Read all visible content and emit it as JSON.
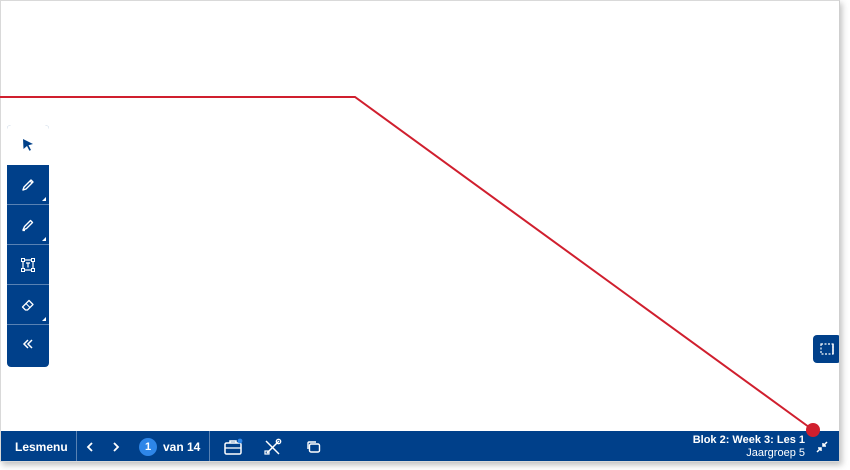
{
  "toolbar": {
    "tools": [
      {
        "icon": "cursor-icon",
        "active": true
      },
      {
        "icon": "pencil-icon"
      },
      {
        "icon": "marker-icon"
      },
      {
        "icon": "text-box-icon"
      },
      {
        "icon": "eraser-icon"
      },
      {
        "icon": "chevron-double-left-icon"
      }
    ]
  },
  "selection_button": {
    "icon": "selection-rectangle-icon"
  },
  "bottombar": {
    "menu_label": "Lesmenu",
    "prev_icon": "chevron-left-icon",
    "next_icon": "chevron-right-icon",
    "current_page": "1",
    "page_total": "van 14",
    "toolbox_icon": "toolbox-icon",
    "tools_icon": "tools-icon",
    "windows_icon": "windows-icon",
    "lesson_title": "Blok 2: Week 3: Les 1",
    "lesson_group": "Jaargroep 5",
    "fullscreen_icon": "exit-fullscreen-icon"
  },
  "colors": {
    "brand_blue": "#00408a",
    "badge_blue": "#2e86e8",
    "annotation_red": "#d01f2e"
  }
}
